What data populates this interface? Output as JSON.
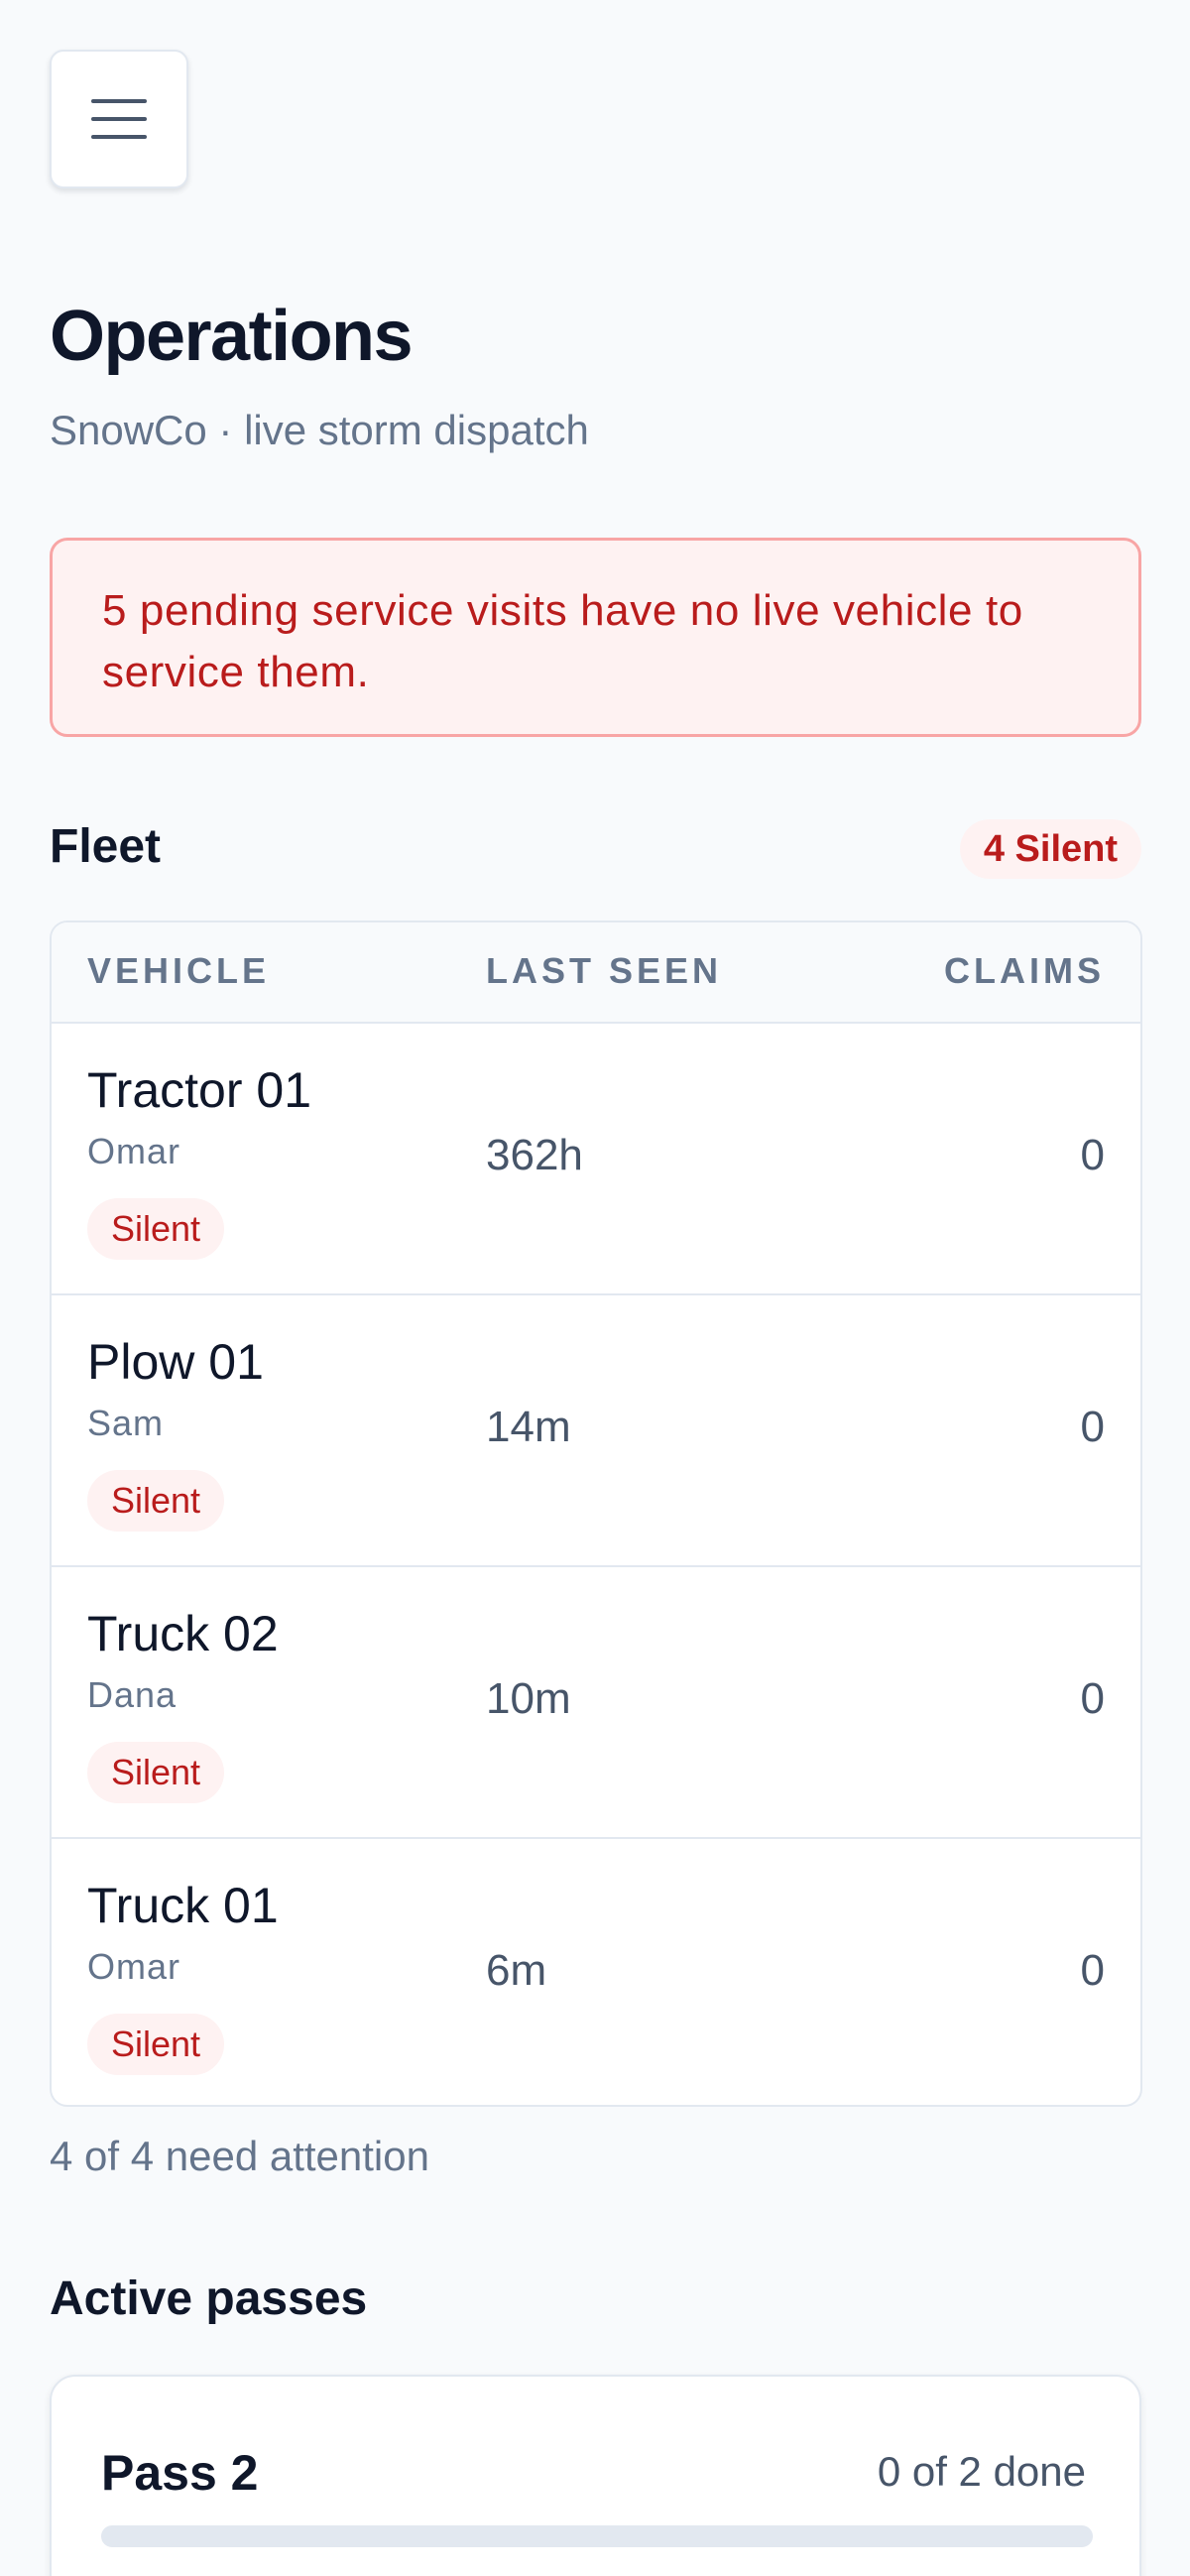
{
  "header": {
    "menu_icon": "hamburger-menu-icon",
    "title": "Operations",
    "subtitle": "SnowCo · live storm dispatch"
  },
  "alert": {
    "message": "5 pending service visits have no live vehicle to service them.",
    "color": "#b91c1c"
  },
  "fleet": {
    "title": "Fleet",
    "silent_badge": "4 Silent",
    "columns": {
      "vehicle": "VEHICLE",
      "last_seen": "LAST SEEN",
      "claims": "CLAIMS"
    },
    "vehicles": [
      {
        "name": "Tractor 01",
        "driver": "Omar",
        "status": "Silent",
        "last_seen": "362h",
        "claims": "0"
      },
      {
        "name": "Plow 01",
        "driver": "Sam",
        "status": "Silent",
        "last_seen": "14m",
        "claims": "0"
      },
      {
        "name": "Truck 02",
        "driver": "Dana",
        "status": "Silent",
        "last_seen": "10m",
        "claims": "0"
      },
      {
        "name": "Truck 01",
        "driver": "Omar",
        "status": "Silent",
        "last_seen": "6m",
        "claims": "0"
      }
    ],
    "summary": "4 of 4 need attention"
  },
  "passes": {
    "title": "Active passes",
    "items": [
      {
        "name": "Pass 2",
        "progress_text": "0 of 2 done",
        "progress": 0
      }
    ]
  },
  "colors": {
    "danger": "#b91c1c",
    "danger_bg": "#fef2f2",
    "muted": "#64748b",
    "background": "#f8fafc"
  }
}
